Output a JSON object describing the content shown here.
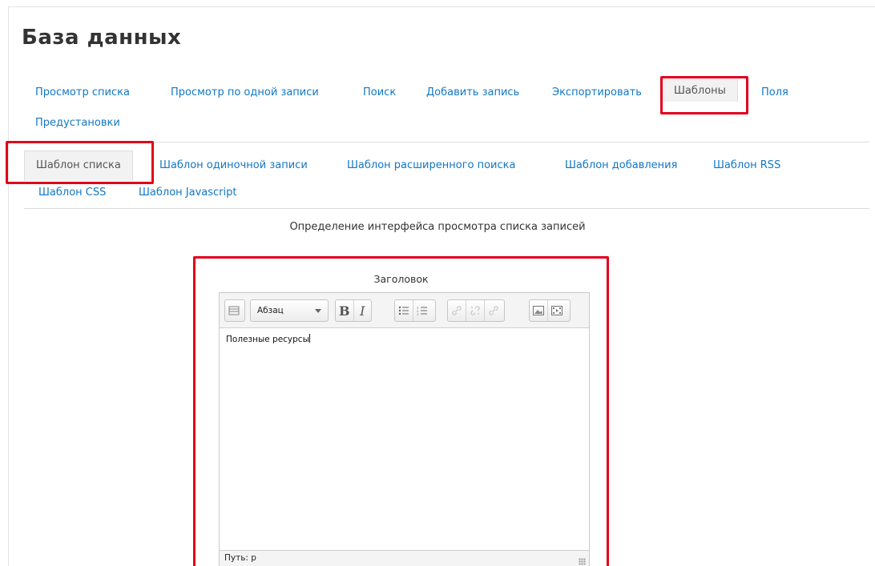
{
  "page": {
    "title": "База данных"
  },
  "main_tabs": [
    {
      "label": "Просмотр списка"
    },
    {
      "label": "Просмотр по одной записи"
    },
    {
      "label": "Поиск"
    },
    {
      "label": "Добавить запись"
    },
    {
      "label": "Экспортировать"
    },
    {
      "label": "Шаблоны",
      "active": true
    },
    {
      "label": "Поля"
    },
    {
      "label": "Предустановки"
    }
  ],
  "template_tabs": [
    {
      "label": "Шаблон списка",
      "active": true
    },
    {
      "label": "Шаблон одиночной записи"
    },
    {
      "label": "Шаблон расширенного поиска"
    },
    {
      "label": "Шаблон добавления"
    },
    {
      "label": "Шаблон RSS"
    },
    {
      "label": "Шаблон CSS"
    },
    {
      "label": "Шаблон Javascript"
    }
  ],
  "section": {
    "description": "Определение интерфейса просмотра списка записей"
  },
  "editor": {
    "label": "Заголовок",
    "format_select": "Абзац",
    "content": "Полезные ресурсы",
    "path": "Путь: p"
  },
  "toolbar_icons": [
    "toolbar-toggle-icon",
    "bold-icon",
    "italic-icon",
    "bullet-list-icon",
    "numbered-list-icon",
    "link-icon",
    "unlink-icon",
    "anchor-icon",
    "image-icon",
    "media-icon"
  ],
  "colors": {
    "link": "#1177c4",
    "highlight": "#e2001a",
    "active_tab_bg": "#f2f2f2"
  }
}
